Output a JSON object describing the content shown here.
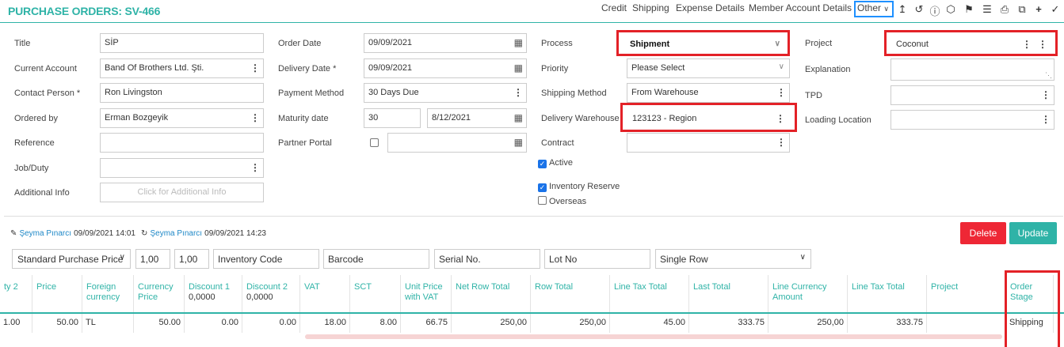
{
  "header": {
    "title": "PURCHASE ORDERS: SV-466",
    "links": [
      "Credit",
      "Shipping",
      "Expense Details",
      "Member Account Details"
    ],
    "other_label": "Other",
    "icons": [
      "upload-icon",
      "history-icon",
      "info-icon",
      "box-icon",
      "bell-icon",
      "list-icon",
      "print-icon",
      "copy-icon",
      "plus-icon",
      "check-icon"
    ]
  },
  "form": {
    "col1": {
      "title_label": "Title",
      "title_value": "SİP",
      "current_account_label": "Current Account",
      "current_account_value": "Band Of Brothers Ltd. Şti.",
      "contact_person_label": "Contact Person *",
      "contact_person_value": "Ron Livingston",
      "ordered_by_label": "Ordered by",
      "ordered_by_value": "Erman Bozgeyik",
      "reference_label": "Reference",
      "reference_value": "",
      "job_duty_label": "Job/Duty",
      "job_duty_value": "",
      "additional_info_label": "Additional Info",
      "additional_info_placeholder": "Click for Additional Info"
    },
    "col2": {
      "order_date_label": "Order Date",
      "order_date_value": "09/09/2021",
      "delivery_date_label": "Delivery Date *",
      "delivery_date_value": "09/09/2021",
      "payment_method_label": "Payment Method",
      "payment_method_value": "30 Days Due",
      "maturity_date_label": "Maturity date",
      "maturity_days_value": "30",
      "maturity_date_value": "8/12/2021",
      "partner_portal_label": "Partner Portal"
    },
    "col3": {
      "process_label": "Process",
      "process_value": "Shipment",
      "priority_label": "Priority",
      "priority_value": "Please Select",
      "shipping_method_label": "Shipping Method",
      "shipping_method_value": "From Warehouse",
      "delivery_warehouse_label": "Delivery Warehouse",
      "delivery_warehouse_value": "123123 - Region",
      "contract_label": "Contract",
      "contract_value": "",
      "active_label": "Active",
      "active_checked": true,
      "inventory_reserve_label": "Inventory Reserve",
      "inventory_reserve_checked": true,
      "overseas_label": "Overseas",
      "overseas_checked": false
    },
    "col4": {
      "project_label": "Project",
      "project_value": "Coconut",
      "explanation_label": "Explanation",
      "explanation_value": "",
      "tpd_label": "TPD",
      "tpd_value": "",
      "loading_location_label": "Loading Location",
      "loading_location_value": ""
    }
  },
  "record_info": {
    "created_by": "Şeyma Pınarcı",
    "created_at": "09/09/2021 14:01",
    "updated_by": "Şeyma Pınarcı",
    "updated_at": "09/09/2021 14:23"
  },
  "actions": {
    "delete_label": "Delete",
    "update_label": "Update"
  },
  "filters": {
    "price_type": "Standard Purchase Price",
    "value1": "1,00",
    "value2": "1,00",
    "inventory_code_placeholder": "Inventory Code",
    "barcode_placeholder": "Barcode",
    "serial_no_placeholder": "Serial No.",
    "lot_no_placeholder": "Lot No",
    "row_mode": "Single Row"
  },
  "table": {
    "columns": [
      {
        "label": "ty 2",
        "sub": ""
      },
      {
        "label": "Price",
        "sub": ""
      },
      {
        "label": "Foreign currency",
        "sub": ""
      },
      {
        "label": "Currency Price",
        "sub": ""
      },
      {
        "label": "Discount 1",
        "sub": "0,0000"
      },
      {
        "label": "Discount 2",
        "sub": "0,0000"
      },
      {
        "label": "VAT",
        "sub": ""
      },
      {
        "label": "SCT",
        "sub": ""
      },
      {
        "label": "Unit Price with VAT",
        "sub": ""
      },
      {
        "label": "Net Row Total",
        "sub": ""
      },
      {
        "label": "Row Total",
        "sub": ""
      },
      {
        "label": "Line Tax Total",
        "sub": ""
      },
      {
        "label": "Last Total",
        "sub": ""
      },
      {
        "label": "Line Currency Amount",
        "sub": ""
      },
      {
        "label": "Line Tax Total",
        "sub": ""
      },
      {
        "label": "Project",
        "sub": ""
      },
      {
        "label": "Order Stage",
        "sub": ""
      }
    ],
    "rows": [
      [
        "1.00",
        "50.00",
        "TL",
        "50.00",
        "0.00",
        "0.00",
        "18.00",
        "8.00",
        "66.75",
        "250,00",
        "250,00",
        "45.00",
        "333.75",
        "250,00",
        "333.75",
        "",
        "Shipping"
      ]
    ]
  },
  "colors": {
    "accent": "#2fb3a7",
    "delete": "#ee2735",
    "update": "#2fb3a7",
    "highlight_red": "#e32127",
    "highlight_blue": "#1e90ff"
  }
}
